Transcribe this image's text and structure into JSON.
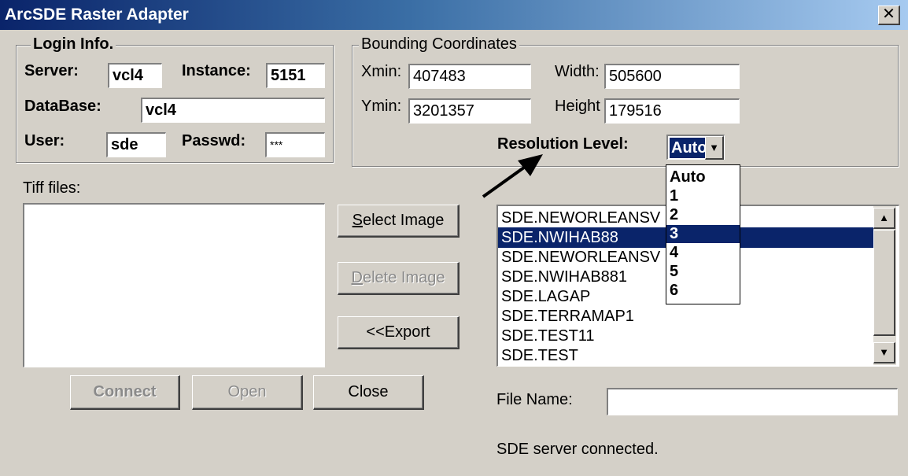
{
  "window": {
    "title": "ArcSDE Raster Adapter",
    "close_glyph": "✕"
  },
  "login": {
    "legend": "Login Info.",
    "server_label": "Server:",
    "server_value": "vcl4",
    "instance_label": "Instance:",
    "instance_value": "5151",
    "database_label": "DataBase:",
    "database_value": "vcl4",
    "user_label": "User:",
    "user_value": "sde",
    "passwd_label": "Passwd:",
    "passwd_value": "***"
  },
  "bounding": {
    "legend": "Bounding Coordinates",
    "xmin_label": "Xmin:",
    "xmin_value": "407483",
    "ymin_label": "Ymin:",
    "ymin_value": "3201357",
    "width_label": "Width:",
    "width_value": "505600",
    "height_label": "Height",
    "height_value": "179516",
    "resolution_label": "Resolution Level:",
    "resolution_value": "Auto"
  },
  "resolution_options": [
    "Auto",
    "1",
    "2",
    "3",
    "4",
    "5",
    "6"
  ],
  "resolution_highlighted": "3",
  "tiff": {
    "label": "Tiff files:",
    "items": []
  },
  "buttons": {
    "select_image": "Select Image",
    "delete_image": "Delete Image",
    "export": "<<Export",
    "connect": "Connect",
    "open": "Open",
    "close": "Close"
  },
  "sde_list": {
    "items": [
      "SDE.NEWORLEANSV",
      "SDE.NWIHAB88",
      "SDE.NEWORLEANSV",
      "SDE.NWIHAB881",
      "SDE.LAGAP",
      "SDE.TERRAMAP1",
      "SDE.TEST11",
      "SDE.TEST"
    ],
    "selected_index": 1
  },
  "file_name": {
    "label": "File Name:",
    "value": ""
  },
  "status": "SDE server connected.",
  "icons": {
    "scroll_up": "▲",
    "scroll_down": "▼",
    "combo_arrow": "▼"
  }
}
